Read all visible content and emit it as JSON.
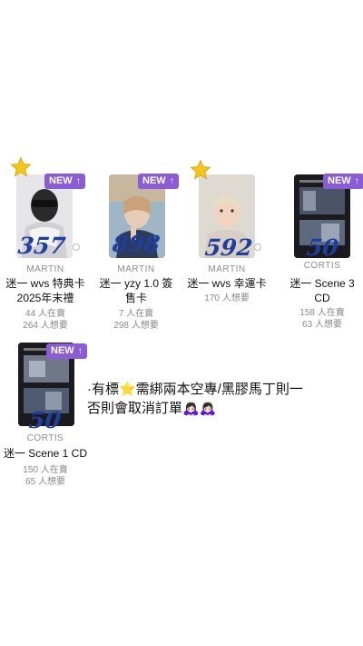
{
  "cards": [
    {
      "badge": "NEW",
      "price_mark": "357",
      "brand": "MARTIN",
      "title_line1": "迷一 wvs 特典卡",
      "title_line2": "2025年末禮",
      "stat1": "44 人在賣",
      "stat2": "264 人想要",
      "starred": true
    },
    {
      "badge": "NEW",
      "price_mark": "898",
      "brand": "MARTIN",
      "title_line1": "迷一 yzy 1.0 簽",
      "title_line2": "售卡",
      "stat1": "7 人在賣",
      "stat2": "298 人想要",
      "starred": false
    },
    {
      "badge": "",
      "price_mark": "592",
      "brand": "MARTIN",
      "title_line1": "迷一 wvs 幸運卡",
      "title_line2": "",
      "stat1": "170 人想要",
      "stat2": "",
      "starred": true
    },
    {
      "badge": "NEW",
      "price_mark": "50",
      "brand": "CORTIS",
      "title_line1": "迷一 Scene 3",
      "title_line2": "CD",
      "stat1": "158 人在賣",
      "stat2": "63 人想要",
      "starred": false
    },
    {
      "badge": "NEW",
      "price_mark": "50",
      "brand": "CORTIS",
      "title_line1": "迷一 Scene 1 CD",
      "title_line2": "",
      "stat1": "150 人在賣",
      "stat2": "65 人想要",
      "starred": false
    }
  ],
  "note": {
    "line1": "·有標⭐需綁兩本空專/黑膠馬丁則一",
    "line2": "否則會取消訂單🙇🏻‍♀️🙇🏻‍♀️"
  },
  "colors": {
    "badge": "#8b5cd6",
    "price_ink": "#1f3f9e",
    "star": "#f5c518"
  },
  "icons": [
    "star-icon",
    "arrow-up-icon"
  ]
}
